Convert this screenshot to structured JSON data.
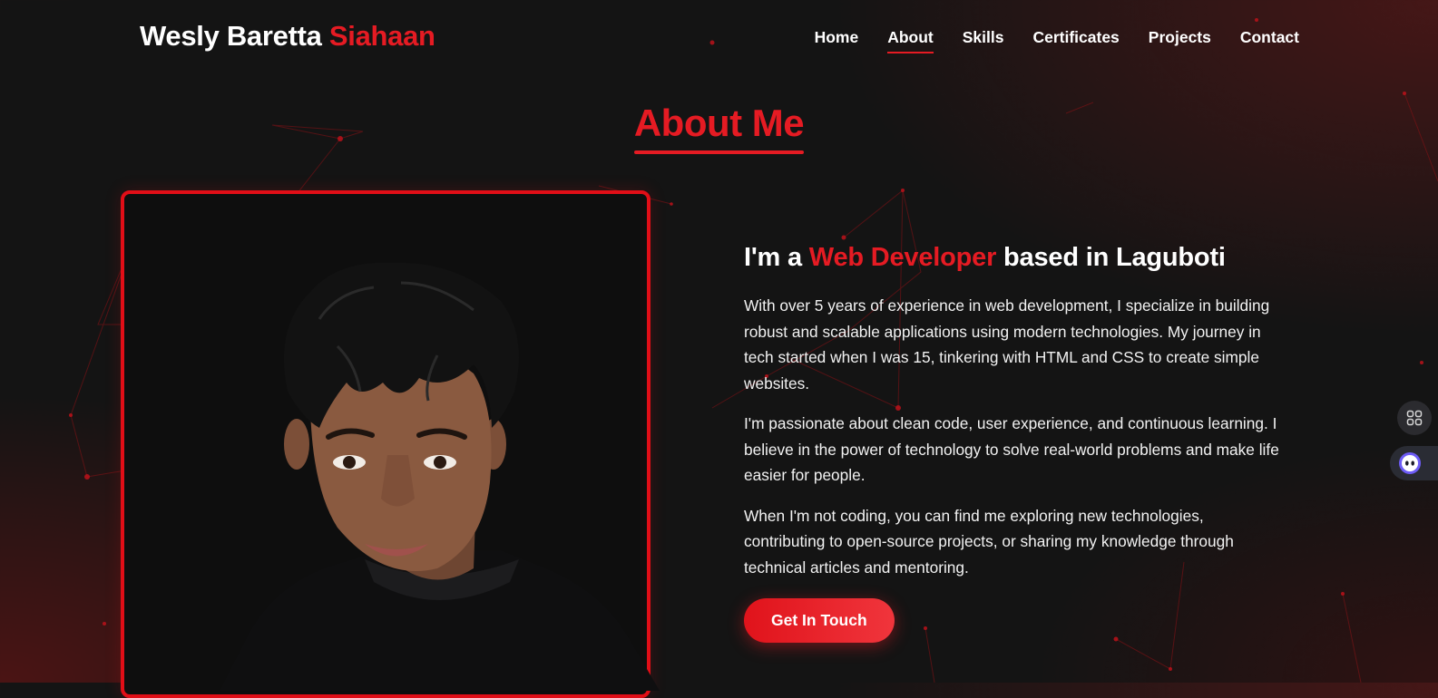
{
  "header": {
    "brand_first": "Wesly Baretta",
    "brand_accent": "Siahaan",
    "nav": [
      {
        "label": "Home",
        "active": false
      },
      {
        "label": "About",
        "active": true
      },
      {
        "label": "Skills",
        "active": false
      },
      {
        "label": "Certificates",
        "active": false
      },
      {
        "label": "Projects",
        "active": false
      },
      {
        "label": "Contact",
        "active": false
      }
    ]
  },
  "about": {
    "title": "About Me",
    "headline_prefix": "I'm a",
    "headline_accent": "Web Developer",
    "headline_suffix": "based in Laguboti",
    "paragraphs": [
      "With over 5 years of experience in web development, I specialize in building robust and scalable applications using modern technologies. My journey in tech started when I was 15, tinkering with HTML and CSS to create simple websites.",
      "I'm passionate about clean code, user experience, and continuous learning. I believe in the power of technology to solve real-world problems and make life easier for people.",
      "When I'm not coding, you can find me exploring new technologies, contributing to open-source projects, or sharing my knowledge through technical articles and mentoring."
    ],
    "cta_label": "Get In Touch"
  },
  "side_widgets": {
    "grid_icon": "apps-grid-icon",
    "assistant_icon": "assistant-bot-icon"
  },
  "colors": {
    "accent": "#e51b23",
    "background": "#141414",
    "text": "#ffffff"
  }
}
